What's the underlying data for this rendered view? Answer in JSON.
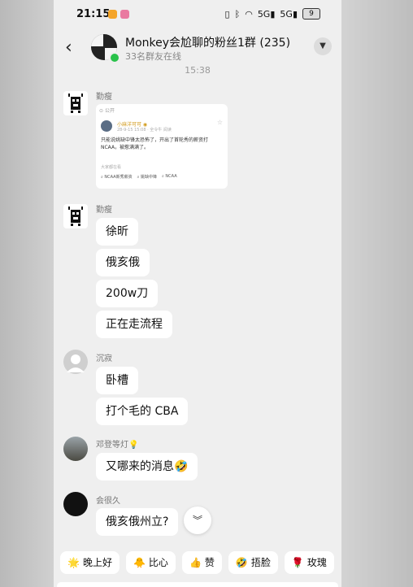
{
  "status_bar": {
    "time": "21:15",
    "signal_1": "5G",
    "signal_2": "5G",
    "battery": "9"
  },
  "header": {
    "title": "Monkey会尬聊的粉丝1群 (235)",
    "subtitle": "33名群友在线"
  },
  "timestamp": "15:38",
  "messages": [
    {
      "sender": "勤瘦",
      "type": "card",
      "card": {
        "top_label": "公开",
        "username": "小麻洋可可",
        "meta": "28-9-15 15:08 · 全令牛 阅读",
        "text": "只能说姚缺中锋太恐怖了，开出了首轮秀的薪资打NCAA，被惹满满了。",
        "footer": "大家都在看",
        "tags": [
          "NCAA新秀薪资",
          "姚缺中锋",
          "NCAA"
        ]
      }
    },
    {
      "sender": "勤瘦",
      "type": "text",
      "bubbles": [
        "徐昕",
        "俄亥俄",
        "200w刀",
        "正在走流程"
      ]
    },
    {
      "sender": "沉寂",
      "type": "text",
      "bubbles": [
        "卧槽",
        "打个毛的 CBA"
      ]
    },
    {
      "sender": "邓登等灯💡",
      "type": "text",
      "bubbles": [
        "又哪来的消息🤣"
      ]
    },
    {
      "sender": "会很久",
      "type": "text",
      "bubbles": [
        "俄亥俄州立?"
      ]
    }
  ],
  "quick_replies": [
    {
      "emoji": "🌟",
      "label": "晚上好"
    },
    {
      "emoji": "🐥",
      "label": "比心"
    },
    {
      "emoji": "👍",
      "label": "赞"
    },
    {
      "emoji": "🤣",
      "label": "捂脸"
    },
    {
      "emoji": "🌹",
      "label": "玫瑰"
    }
  ],
  "icons": {
    "back": "chevron-left-icon",
    "more": "caret-down-icon",
    "scroll_down": "double-chevron-down-icon"
  },
  "colors": {
    "online": "#29c24a",
    "chat_bg": "#efefef",
    "bubble": "#ffffff"
  }
}
